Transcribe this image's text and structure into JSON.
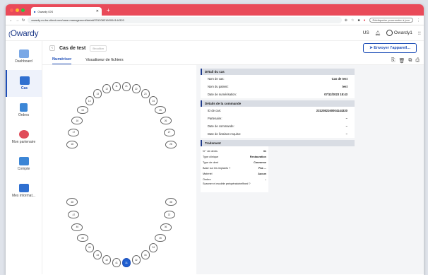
{
  "browser": {
    "tab_title": "Owardy IOS",
    "url": "owardy-eu.bs-client.com/case-management/detail/2312082160004144320",
    "profile_label": "Réétiqueter pourrendre à jour"
  },
  "app": {
    "logo": "Owardy",
    "lang": "US",
    "user": "Owardy1"
  },
  "sidebar": {
    "items": [
      {
        "label": "Dashboard",
        "color": "#5b8fd8"
      },
      {
        "label": "Cas",
        "color": "#2f6fd0"
      },
      {
        "label": "Ordres",
        "color": "#3c86d6"
      },
      {
        "label": "Mon partenaire",
        "color": "#e04c5a"
      },
      {
        "label": "Compte",
        "color": "#3c86d6"
      },
      {
        "label": "Mes informat...",
        "color": "#2f6fd0"
      }
    ]
  },
  "case": {
    "title": "Cas de test",
    "badge": "Brouillon",
    "send_label": "Envoyer l'appareil..."
  },
  "tabs": [
    "Numériser",
    "Visualiseur de fichiers"
  ],
  "details": {
    "case_section": "Détail du cas",
    "case_rows": [
      {
        "label": "Nom de cas:",
        "value": "Cas de test"
      },
      {
        "label": "Nom du patient:",
        "value": "test"
      },
      {
        "label": "Date de numérisation:",
        "value": "07/12/2023 18:43"
      }
    ],
    "order_section": "Détails de la commande",
    "order_rows": [
      {
        "label": "ID de cas:",
        "value": "2312082160004144320"
      },
      {
        "label": "Partenaire:",
        "value": "–"
      },
      {
        "label": "Date de commande:",
        "value": "–"
      },
      {
        "label": "Date de livraison requise:",
        "value": "–"
      }
    ],
    "treatment_section": "Traitement",
    "treatment_rows": [
      {
        "label": "N ° de dents",
        "value": "31"
      },
      {
        "label": "Type clinique",
        "value": "Restauration"
      },
      {
        "label": "Type de dent",
        "value": "Couronne"
      },
      {
        "label": "Basé sur les implants ?",
        "value": "Pas ..."
      },
      {
        "label": "Matériel",
        "value": "Aucun"
      },
      {
        "label": "Ombre",
        "value": "–"
      },
      {
        "label": "Scanner ni modèle préopératoire/fixed ?",
        "value": ""
      }
    ]
  },
  "teeth": {
    "upper": [
      "18",
      "17",
      "16",
      "15",
      "14",
      "13",
      "12",
      "11",
      "21",
      "22",
      "23",
      "24",
      "25",
      "26",
      "27",
      "28"
    ],
    "lower": [
      "48",
      "47",
      "46",
      "45",
      "44",
      "43",
      "42",
      "41",
      "31",
      "32",
      "33",
      "34",
      "35",
      "36",
      "37",
      "38"
    ],
    "selected": "31"
  }
}
